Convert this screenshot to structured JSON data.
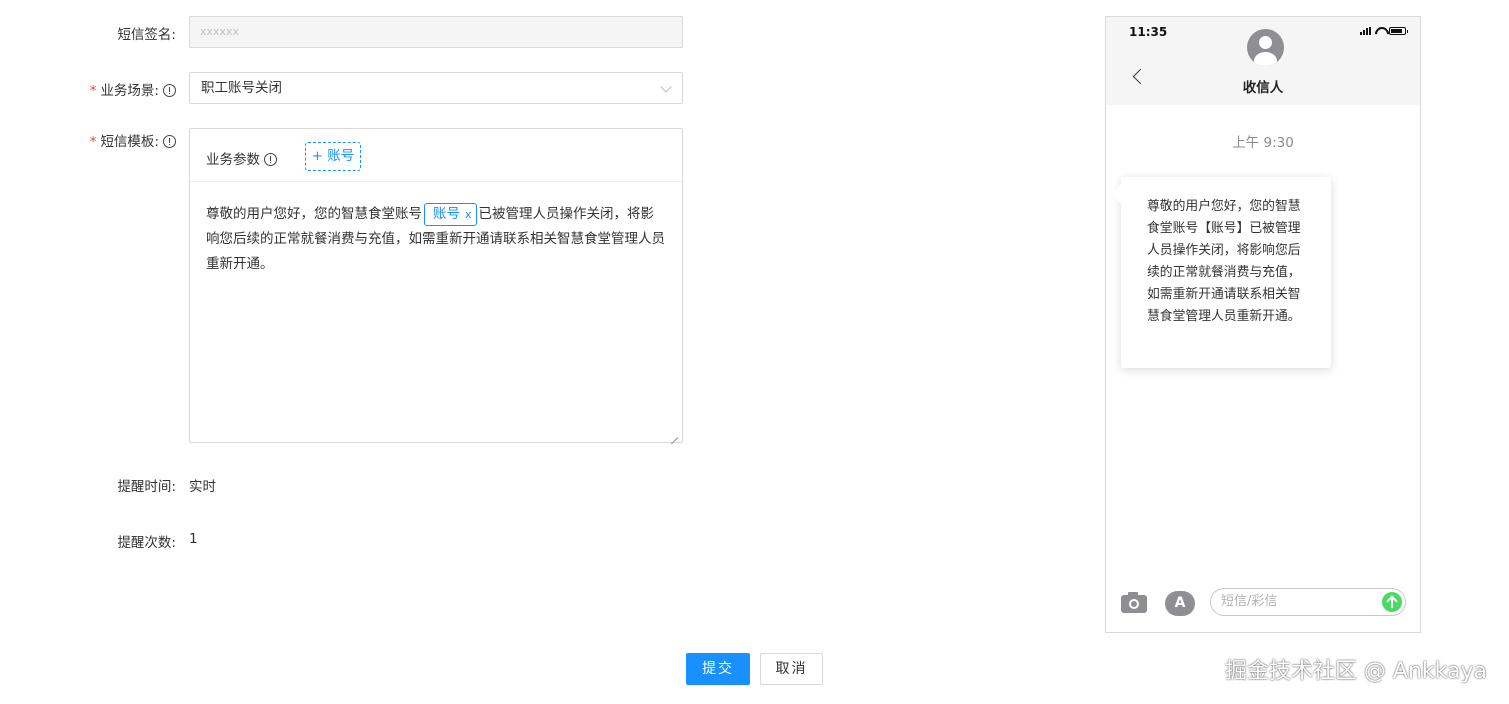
{
  "form": {
    "signature": {
      "label": "短信签名:",
      "value": "xxxxxx"
    },
    "scene": {
      "label": "业务场景:",
      "selected": "职工账号关闭"
    },
    "template": {
      "label": "短信模板:",
      "params_label": "业务参数",
      "add_param_label": "+ 账号",
      "content_before": "尊敬的用户您好，您的智慧食堂账号",
      "tag_label": "账号",
      "tag_remove": "x",
      "content_after": "已被管理人员操作关闭，将影响您后续的正常就餐消费与充值，如需重新开通请联系相关智慧食堂管理人员重新开通。"
    },
    "remind_time": {
      "label": "提醒时间:",
      "value": "实时"
    },
    "remind_count": {
      "label": "提醒次数:",
      "value": "1"
    }
  },
  "actions": {
    "submit_label": "提交",
    "cancel_label": "取消"
  },
  "phone": {
    "time": "11:35",
    "recipient": "收信人",
    "message_time": "上午 9:30",
    "message": "尊敬的用户您好，您的智慧食堂账号【账号】已被管理人员操作关闭，将影响您后续的正常就餐消费与充值，如需重新开通请联系相关智慧食堂管理人员重新开通。",
    "input_placeholder": "短信/彩信",
    "apps_glyph": "A"
  },
  "watermark": "掘金技术社区 @ Ankkaya",
  "colors": {
    "primary": "#1890ff",
    "required": "#f04134",
    "send": "#4cd964"
  },
  "icons": [
    "info-icon",
    "chevron-down-icon",
    "back-chevron-icon",
    "avatar-icon",
    "camera-icon",
    "app-store-icon",
    "send-arrow-icon"
  ]
}
